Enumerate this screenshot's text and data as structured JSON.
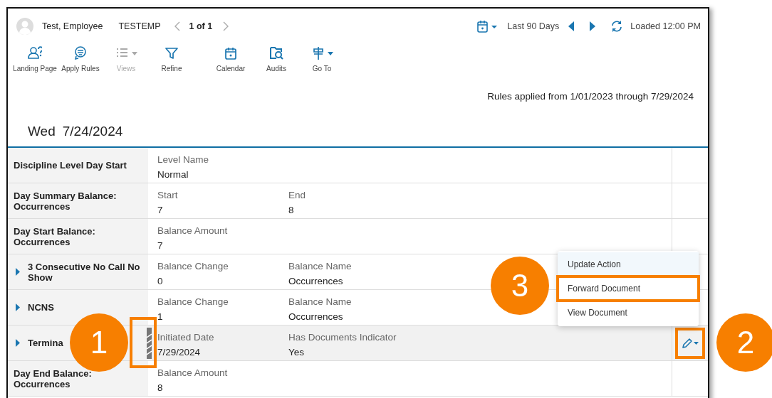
{
  "header": {
    "employee_name": "Test, Employee",
    "employee_id": "TESTEMP",
    "pager": "1 of 1",
    "range": "Last 90 Days",
    "loaded": "Loaded 12:00 PM"
  },
  "toolbar": [
    {
      "label": "Landing Page",
      "disabled": false,
      "dropdown": false
    },
    {
      "label": "Apply Rules",
      "disabled": false,
      "dropdown": false
    },
    {
      "label": "Views",
      "disabled": true,
      "dropdown": true
    },
    {
      "label": "Refine",
      "disabled": false,
      "dropdown": false
    },
    {
      "label": "Calendar",
      "disabled": false,
      "dropdown": false
    },
    {
      "label": "Audits",
      "disabled": false,
      "dropdown": false
    },
    {
      "label": "Go To",
      "disabled": false,
      "dropdown": true
    }
  ],
  "rules_note": "Rules applied from 1/01/2023 through 7/29/2024",
  "day": {
    "weekday": "Wed",
    "date": "7/24/2024"
  },
  "rows": [
    {
      "label": "Discipline Level Day Start",
      "expandable": false,
      "selected": false,
      "has_action": false,
      "fields": [
        {
          "name": "Level Name",
          "value": "Normal"
        }
      ]
    },
    {
      "label": "Day Summary Balance: Occurrences",
      "expandable": false,
      "selected": false,
      "has_action": false,
      "fields": [
        {
          "name": "Start",
          "value": "7"
        },
        {
          "name": "End",
          "value": "8"
        }
      ]
    },
    {
      "label": "Day Start Balance: Occurrences",
      "expandable": false,
      "selected": false,
      "has_action": false,
      "fields": [
        {
          "name": "Balance Amount",
          "value": "7"
        }
      ]
    },
    {
      "label": "3 Consecutive No Call No Show",
      "expandable": true,
      "selected": false,
      "has_action": false,
      "fields": [
        {
          "name": "Balance Change",
          "value": "0"
        },
        {
          "name": "Balance Name",
          "value": "Occurrences"
        }
      ]
    },
    {
      "label": "NCNS",
      "expandable": true,
      "selected": false,
      "has_action": false,
      "fields": [
        {
          "name": "Balance Change",
          "value": "1"
        },
        {
          "name": "Balance Name",
          "value": "Occurrences"
        }
      ]
    },
    {
      "label": "Termina",
      "expandable": true,
      "selected": true,
      "has_action": true,
      "striped_marker": true,
      "fields": [
        {
          "name": "Initiated Date",
          "value": "7/29/2024"
        },
        {
          "name": "Has Documents Indicator",
          "value": "Yes"
        }
      ]
    },
    {
      "label": "Day End Balance: Occurrences",
      "expandable": false,
      "selected": false,
      "has_action": false,
      "fields": [
        {
          "name": "Balance Amount",
          "value": "8"
        }
      ]
    }
  ],
  "menu": [
    {
      "label": "Update Action",
      "hovered": true,
      "framed": false
    },
    {
      "label": "Forward Document",
      "hovered": false,
      "framed": true
    },
    {
      "label": "View Document",
      "hovered": false,
      "framed": false
    }
  ],
  "callouts": [
    {
      "number": "1"
    },
    {
      "number": "2"
    },
    {
      "number": "3"
    }
  ]
}
